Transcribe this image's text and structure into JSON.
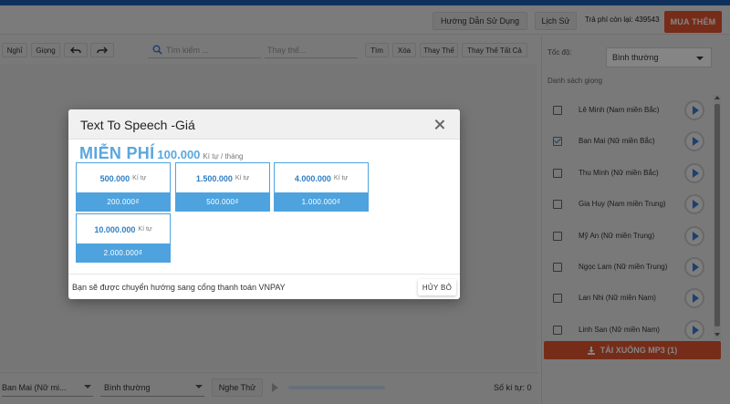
{
  "header": {
    "guide_button": "Hướng Dẫn Sử Dụng",
    "history_button": "Lịch Sử",
    "fee_remaining": "Trả phí còn lại: 439543",
    "buy_button": "MUA THÊM"
  },
  "toolbar": {
    "pause": "Nghỉ",
    "voice": "Giọng",
    "search_placeholder": "Tìm kiếm ...",
    "replace_placeholder": "Thay thế...",
    "find": "Tìm",
    "delete": "Xóa",
    "replace": "Thay Thế",
    "replace_all": "Thay Thế Tất Cả"
  },
  "bottom": {
    "voice_select": "Ban Mai (Nữ mi...",
    "speed_select": "Bình thường",
    "listen_button": "Nghe Thử",
    "char_count": "Số kí tự: 0"
  },
  "right_panel": {
    "speed_label": "Tốc độ:",
    "speed_value": "Bình thường",
    "voice_list_label": "Danh sách giọng",
    "voices": [
      {
        "name": "Lê Minh (Nam miền Bắc)",
        "checked": false
      },
      {
        "name": "Ban Mai (Nữ miền Bắc)",
        "checked": true
      },
      {
        "name": "Thu Minh (Nữ miền Bắc)",
        "checked": false
      },
      {
        "name": "Gia Huy (Nam miền Trung)",
        "checked": false
      },
      {
        "name": "Mỹ An (Nữ miền Trung)",
        "checked": false
      },
      {
        "name": "Ngọc Lam (Nữ miền Trung)",
        "checked": false
      },
      {
        "name": "Lan Nhi (Nữ miền Nam)",
        "checked": false
      },
      {
        "name": "Linh San (Nữ miền Nam)",
        "checked": false
      }
    ],
    "download_button": "TẢI XUỐNG MP3 (1)"
  },
  "modal": {
    "title": "Text To Speech -Giá",
    "free_label": "MIỄN PHÍ",
    "free_amount": "100.000",
    "free_unit": "Kí tự / tháng",
    "packages": [
      {
        "chars": "500.000",
        "unit": "Kí tự",
        "price": "200.000₫"
      },
      {
        "chars": "1.500.000",
        "unit": "Kí tự",
        "price": "500.000₫"
      },
      {
        "chars": "4.000.000",
        "unit": "Kí tự",
        "price": "1.000.000₫"
      },
      {
        "chars": "10.000.000",
        "unit": "Kí tự",
        "price": "2.000.000₫"
      }
    ],
    "redirect_text": "Bạn sẽ được chuyển hướng sang cổng thanh toán VNPAY",
    "cancel_button": "HỦY BỎ"
  },
  "colors": {
    "accent_orange": "#e2552f",
    "accent_blue": "#4ea3de",
    "top_strip": "#1f5fb0"
  }
}
